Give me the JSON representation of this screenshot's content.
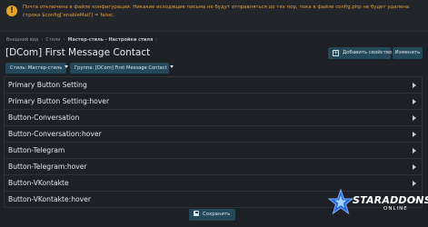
{
  "notice": {
    "text": "Почта отключена в файле конфигурации. Никакие исходящие письма не будут отправляться до тех пор, пока в файле config.php не будет удалена строка $config['enableMail'] = false;."
  },
  "breadcrumb": {
    "items": [
      "Внешний вид",
      "Стили",
      "Мастер-стиль - Настройки стиля"
    ]
  },
  "page": {
    "title": "[DCom] First Message Contact",
    "add_property_label": "Добавить свойство",
    "edit_label": "Изменить",
    "save_label": "Сохранить"
  },
  "filters": {
    "style_label": "Стиль: Мастер-стиль",
    "group_label": "Группа: [DCom] First Message Contact"
  },
  "properties": [
    "Primary Button Setting",
    "Primary Button Setting:hover",
    "Button-Conversation",
    "Button-Conversation:hover",
    "Button-Telegram",
    "Button-Telegram:hover",
    "Button-VKontakte",
    "Button-VKontakte:hover"
  ],
  "watermark": {
    "brand": "STARADDONS",
    "sub": "ONLINE"
  },
  "colors": {
    "background": "#1d2125",
    "button": "#24495a",
    "notice_text": "#e39c3f",
    "notice_icon": "#e6a623"
  }
}
